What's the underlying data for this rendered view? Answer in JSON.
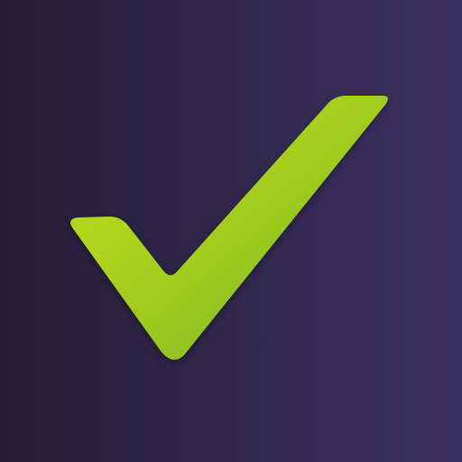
{
  "icon": {
    "name": "checkmark-icon",
    "background": {
      "start_color": "#231d35",
      "end_color": "#3b3262"
    },
    "check": {
      "highlight_color": "#c8e015",
      "mid_color": "#9dcb1f",
      "shadow_color": "#6fae24"
    }
  }
}
